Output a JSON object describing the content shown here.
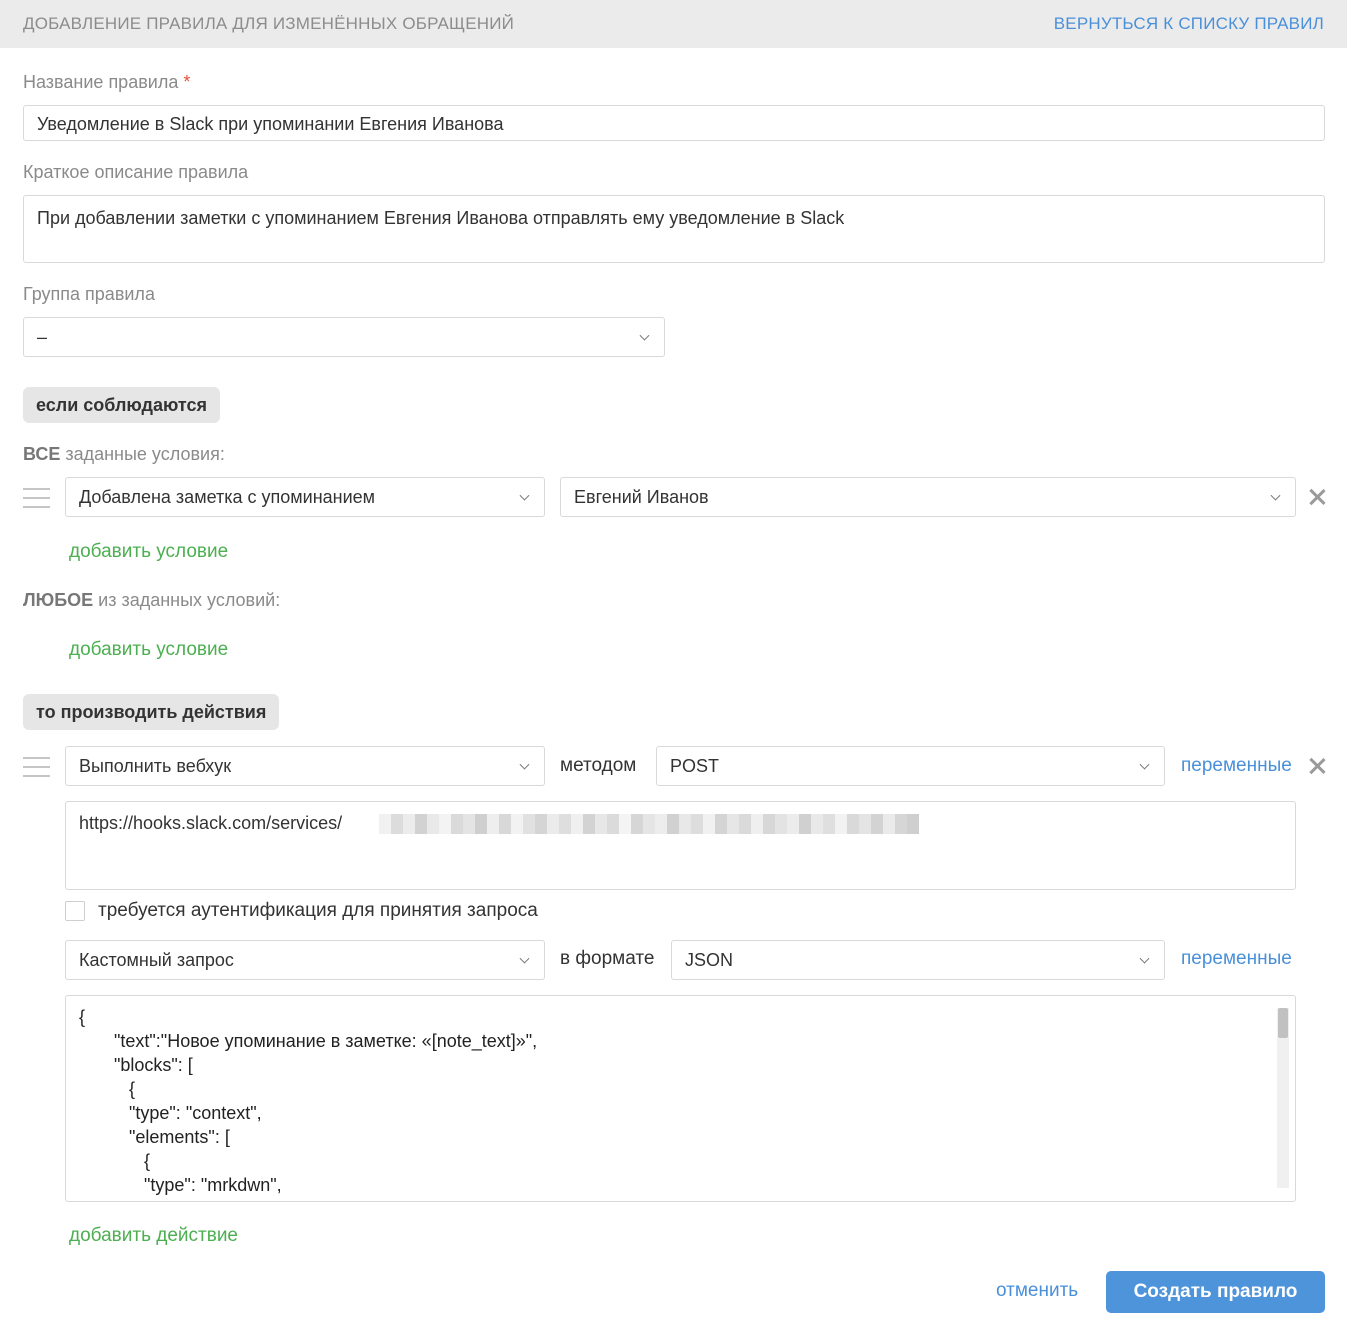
{
  "header": {
    "title": "ДОБАВЛЕНИЕ ПРАВИЛА ДЛЯ ИЗМЕНЁННЫХ ОБРАЩЕНИЙ",
    "back_link": "ВЕРНУТЬСЯ К СПИСКУ ПРАВИЛ"
  },
  "rule_name": {
    "label": "Название правила",
    "required_mark": "*",
    "value": "Уведомление в Slack при упоминании Евгения Иванова"
  },
  "rule_description": {
    "label": "Краткое описание правила",
    "value": "При добавлении заметки с упоминанием Евгения Иванова отправлять ему уведомление в Slack"
  },
  "rule_group": {
    "label": "Группа правила",
    "value": "–"
  },
  "conditions": {
    "section_label": "если соблюдаются",
    "all": {
      "title_bold": "ВСЕ",
      "title_rest": " заданные условия:",
      "rows": [
        {
          "type": "Добавлена заметка с упоминанием",
          "value": "Евгений Иванов"
        }
      ],
      "add_label": "добавить условие"
    },
    "any": {
      "title_bold": "ЛЮБОЕ",
      "title_rest": " из заданных условий:",
      "add_label": "добавить условие"
    }
  },
  "actions": {
    "section_label": "то производить действия",
    "webhook": {
      "action": "Выполнить вебхук",
      "method_label": "методом",
      "method": "POST",
      "variables_label": "переменные",
      "url": "https://hooks.slack.com/services/",
      "auth_label": "требуется аутентификация для принятия запроса",
      "request_type": "Кастомный запрос",
      "format_label": "в формате",
      "format": "JSON",
      "variables_label_2": "переменные",
      "body": "{\n       \"text\":\"Новое упоминание в заметке: «[note_text]»\",\n       \"blocks\": [\n          {\n          \"type\": \"context\",\n          \"elements\": [\n             {\n             \"type\": \"mrkdwn\",\n             \"text\": \"Заметка от [author]: «[note_text]»\""
    },
    "add_label": "добавить действие"
  },
  "footer": {
    "cancel_label": "отменить",
    "submit_label": "Создать правило"
  }
}
